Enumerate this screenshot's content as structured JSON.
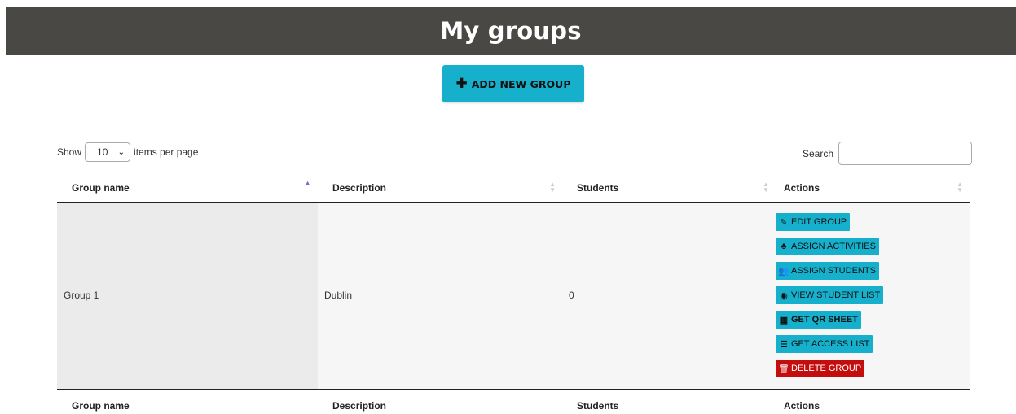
{
  "header": {
    "title": "My groups"
  },
  "add_button": {
    "icon": "plus-icon",
    "label": "ADD NEW GROUP"
  },
  "length_menu": {
    "prefix": "Show",
    "value": "10",
    "suffix": "items per page"
  },
  "search": {
    "label": "Search",
    "value": ""
  },
  "columns": [
    "Group name",
    "Description",
    "Students",
    "Actions"
  ],
  "rows": [
    {
      "group_name": "Group 1",
      "description": "Dublin",
      "students": "0",
      "actions": [
        {
          "icon": "edit-icon",
          "label": "EDIT GROUP"
        },
        {
          "icon": "puzzle-icon",
          "label": "ASSIGN ACTIVITIES"
        },
        {
          "icon": "users-icon",
          "label": "ASSIGN STUDENTS"
        },
        {
          "icon": "eye-icon",
          "label": "VIEW STUDENT LIST"
        },
        {
          "icon": "qrcode-icon",
          "label": "GET QR SHEET"
        },
        {
          "icon": "list-icon",
          "label": "GET ACCESS LIST"
        },
        {
          "icon": "trash-icon",
          "label": "DELETE GROUP"
        }
      ]
    }
  ],
  "colors": {
    "header_bg": "#4a4845",
    "accent": "#17b0cc",
    "danger": "#c40d0d"
  }
}
